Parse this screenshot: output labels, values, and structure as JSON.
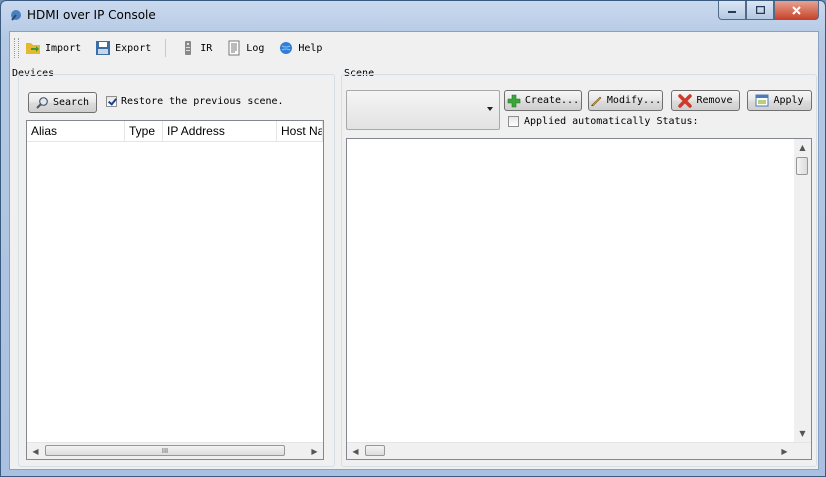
{
  "window": {
    "title": "HDMI over IP Console"
  },
  "toolbar": {
    "import_label": "Import",
    "export_label": "Export",
    "ir_label": "IR",
    "log_label": "Log",
    "help_label": "Help"
  },
  "devices": {
    "group_label": "Devices",
    "search_label": "Search",
    "restore_label": "Restore the previous scene.",
    "restore_checked": true,
    "columns": [
      "Alias",
      "Type",
      "IP Address",
      "Host Na"
    ],
    "scroll_thumb_grip": "III"
  },
  "scene": {
    "group_label": "Scene",
    "create_label": "Create...",
    "modify_label": "Modify...",
    "remove_label": "Remove",
    "apply_label": "Apply",
    "applied_auto_label": "Applied automatically",
    "applied_auto_checked": false,
    "status_label": "Status:"
  },
  "colors": {
    "accent": "#3a6ea5",
    "close_button": "#c7452b",
    "create_icon": "#3aa63a",
    "remove_icon": "#d03a2a"
  }
}
